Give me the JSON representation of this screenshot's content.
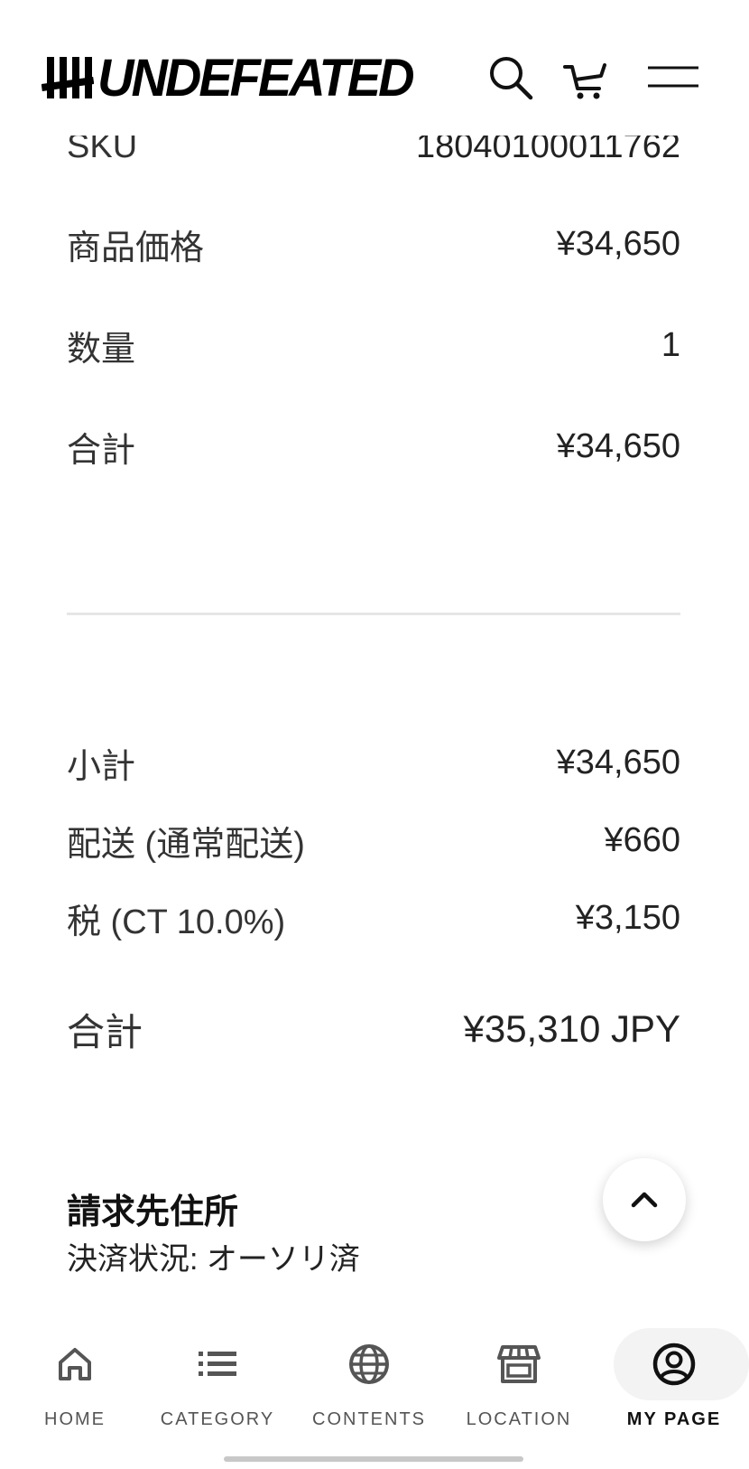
{
  "header": {
    "brand": "UNDEFEATED",
    "icons": [
      "search-icon",
      "cart-icon",
      "menu-icon"
    ]
  },
  "order_item": {
    "sku_label": "SKU",
    "sku_value": "18040100011762",
    "price_label": "商品価格",
    "price_value": "¥34,650",
    "qty_label": "数量",
    "qty_value": "1",
    "total_label": "合計",
    "total_value": "¥34,650"
  },
  "summary": {
    "subtotal_label": "小計",
    "subtotal_value": "¥34,650",
    "shipping_label": "配送 (通常配送)",
    "shipping_value": "¥660",
    "tax_label": "税 (CT 10.0%)",
    "tax_value": "¥3,150",
    "grand_total_label": "合計",
    "grand_total_value": "¥35,310 JPY"
  },
  "billing": {
    "title": "請求先住所",
    "status": "決済状況: オーソリ済"
  },
  "bottom_nav": {
    "items": [
      {
        "label": "HOME",
        "icon": "home-icon"
      },
      {
        "label": "CATEGORY",
        "icon": "list-icon"
      },
      {
        "label": "CONTENTS",
        "icon": "globe-icon"
      },
      {
        "label": "LOCATION",
        "icon": "store-icon"
      },
      {
        "label": "MY PAGE",
        "icon": "account-circle-icon"
      }
    ],
    "active": "MY PAGE"
  },
  "colors": {
    "text": "#222222",
    "label": "#333333",
    "divider": "#e6e6e6",
    "active_bg": "#f3f3f3"
  }
}
